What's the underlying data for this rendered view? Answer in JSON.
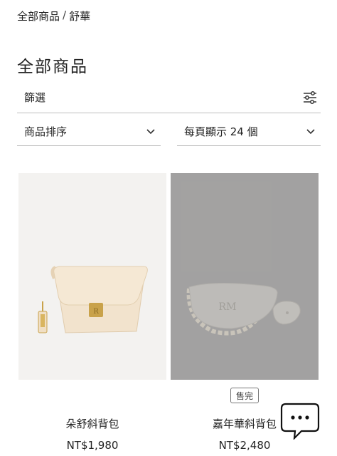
{
  "breadcrumb": {
    "root": "全部商品",
    "separator": "/",
    "current": "舒華"
  },
  "page_title": "全部商品",
  "filter": {
    "label": "篩選",
    "icon": "sliders-icon"
  },
  "sort": {
    "label": "商品排序",
    "icon": "chevron-down-icon"
  },
  "per_page": {
    "label": "每頁顯示 24 個",
    "icon": "chevron-down-icon"
  },
  "products": [
    {
      "name": "朵舒斜背包",
      "price": "NT$1,980",
      "sold_out": false
    },
    {
      "name": "嘉年華斜背包",
      "price": "NT$2,480",
      "sold_out": true,
      "badge": "售完"
    }
  ],
  "chat": {
    "icon": "chat-bubble-icon"
  },
  "colors": {
    "text": "#222222",
    "divider": "#bdbdbd",
    "sold_out_bg": "#aaa9a8",
    "bag1": "#f0e0c8",
    "hardware_gold": "#c9a24a"
  }
}
